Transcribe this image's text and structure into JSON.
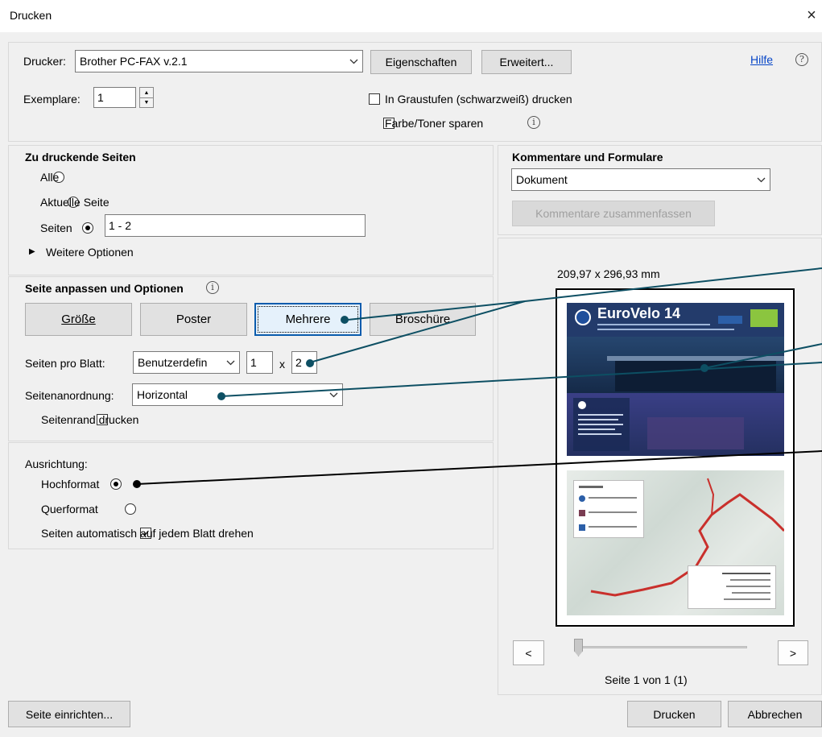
{
  "window": {
    "title": "Drucken",
    "close": "×"
  },
  "top": {
    "printer_label": "Drucker:",
    "printer_value": "Brother PC-FAX v.2.1",
    "properties_button": "Eigenschaften",
    "advanced_button": "Erweitert...",
    "help_link": "Hilfe",
    "copies_label": "Exemplare:",
    "copies_value": "1",
    "grayscale_label": "In Graustufen (schwarzweiß) drucken",
    "toner_label": "Farbe/Toner sparen"
  },
  "pages": {
    "heading": "Zu druckende Seiten",
    "all": "Alle",
    "current": "Aktuelle Seite",
    "pages": "Seiten",
    "pages_value": "1 - 2",
    "more_options": "Weitere Optionen"
  },
  "fit": {
    "heading": "Seite anpassen und Optionen",
    "tabs": [
      "Größe",
      "Poster",
      "Mehrere",
      "Broschüre"
    ],
    "pages_per_sheet_label": "Seiten pro Blatt:",
    "pages_per_sheet_value": "Benutzerdefin",
    "cols": "1",
    "times": "x",
    "rows": "2",
    "order_label": "Seitenanordnung:",
    "order_value": "Horizontal",
    "border_label": "Seitenrand drucken"
  },
  "orientation": {
    "heading": "Ausrichtung:",
    "portrait": "Hochformat",
    "landscape": "Querformat",
    "autorotate": "Seiten automatisch auf jedem Blatt drehen"
  },
  "comments": {
    "heading": "Kommentare und Formulare",
    "value": "Dokument",
    "summarize_button": "Kommentare zusammenfassen"
  },
  "preview": {
    "size": "209,97 x 296,93 mm",
    "page1_title": "EuroVelo 14",
    "prev": "<",
    "next": ">",
    "page_status": "Seite 1 von 1 (1)"
  },
  "bottom": {
    "page_setup": "Seite einrichten...",
    "print": "Drucken",
    "cancel": "Abbrechen"
  },
  "colors": {
    "focus_blue": "#0b5cad",
    "callout_teal": "#0d4f63",
    "link_blue": "#0645c7"
  }
}
